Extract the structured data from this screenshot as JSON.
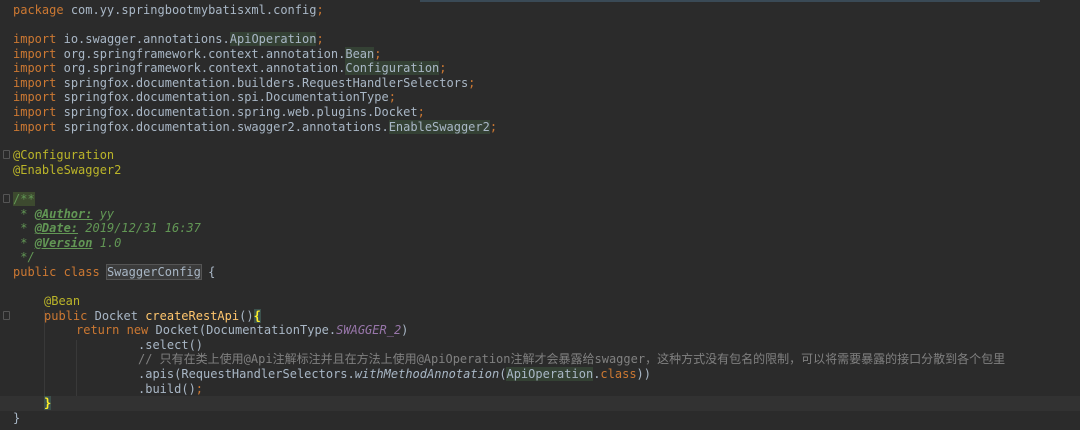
{
  "code": {
    "package_kw": "package",
    "package_name": "com.yy.springbootmybatisxml.config",
    "import_kw": "import",
    "imports": [
      {
        "prefix": "io.swagger.annotations.",
        "name": "ApiOperation"
      },
      {
        "prefix": "org.springframework.context.annotation.",
        "name": "Bean"
      },
      {
        "prefix": "org.springframework.context.annotation.",
        "name": "Configuration"
      },
      {
        "prefix": "springfox.documentation.builders.RequestHandlerSelectors",
        "name": ""
      },
      {
        "prefix": "springfox.documentation.spi.DocumentationType",
        "name": ""
      },
      {
        "prefix": "springfox.documentation.spring.web.plugins.Docket",
        "name": ""
      },
      {
        "prefix": "springfox.documentation.swagger2.annotations.",
        "name": "EnableSwagger2"
      }
    ],
    "annotation_configuration": "@Configuration",
    "annotation_enable_swagger": "@EnableSwagger2",
    "doc_open": "/**",
    "doc_author_tag": "@Author:",
    "doc_author_value": " yy",
    "doc_date_tag": "@Date:",
    "doc_date_value": " 2019/12/31 16:37",
    "doc_version_tag": "@Version",
    "doc_version_value": " 1.0",
    "doc_star": " * ",
    "doc_close": " */",
    "public_kw": "public",
    "class_kw": "class",
    "class_name": "SwaggerConfig",
    "open_brace": " {",
    "annotation_bean": "@Bean",
    "return_type": "Docket",
    "method_name": "createRestApi",
    "method_parens": "()",
    "return_kw": "return",
    "new_kw": "new",
    "docket_ctor": "Docket(DocumentationType.",
    "swagger_const": "SWAGGER_2",
    "close_paren": ")",
    "select_call": ".select()",
    "comment_line": "// 只有在类上使用@Api注解标注并且在方法上使用@ApiOperation注解才会暴露给swagger，这种方式没有包名的限制，可以将需要暴露的接口分散到各个包里",
    "apis_prefix": ".apis(RequestHandlerSelectors.",
    "apis_method": "withMethodAnnotation",
    "apis_arg_open": "(",
    "apis_arg_class": "ApiOperation",
    "apis_arg_dot": ".",
    "apis_class_kw": "class",
    "apis_close": "))",
    "build_call": ".build()",
    "semicolon": ";",
    "close_brace": "}"
  }
}
